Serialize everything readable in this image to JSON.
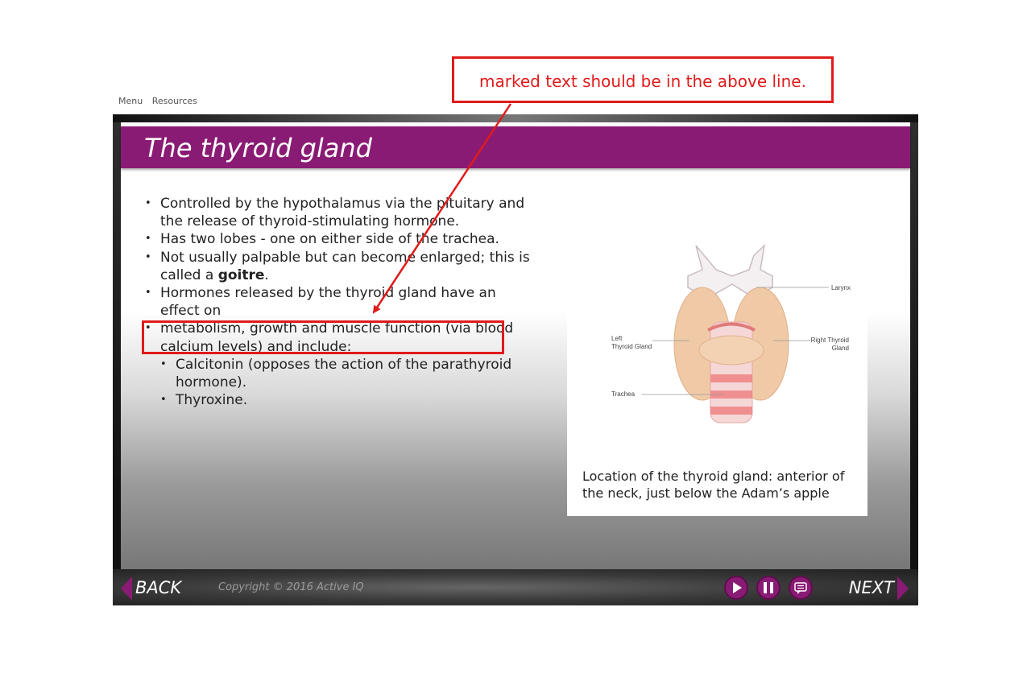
{
  "topnav": {
    "menu": "Menu",
    "resources": "Resources"
  },
  "slide": {
    "title": "The thyroid gland",
    "bullets": [
      "Controlled by the hypothalamus via the pituitary and the release of thyroid-stimulating hormone.",
      "Has two lobes - one on either side of the trachea.",
      "Not usually palpable but can become enlarged; this is called a ",
      "goitre",
      ".",
      "Hormones released by the thyroid gland have an effect on",
      "metabolism, growth and muscle function (via blood calcium levels) and include:"
    ],
    "sub_bullets": [
      "Calcitonin (opposes the action of the parathyroid hormone).",
      "Thyroxine."
    ],
    "figure": {
      "labels": {
        "larynx": "Larynx",
        "left_1": "Left",
        "left_2": "Thyroid Gland",
        "right_1": "Right Thyroid",
        "right_2": "Gland",
        "trachea": "Trachea"
      },
      "caption": "Location of the thyroid gland: anterior of the neck, just below the Adam’s apple"
    }
  },
  "bottombar": {
    "back": "BACK",
    "next": "NEXT",
    "copyright": "Copyright © 2016 Active IQ"
  },
  "controls": {
    "play_icon": "play-icon",
    "pause_icon": "pause-icon",
    "transcript_icon": "transcript-icon"
  },
  "annotation": {
    "text": "marked text should be in the above line."
  },
  "colors": {
    "brand_purple": "#8a1b74",
    "annotation_red": "#e01b1b"
  }
}
